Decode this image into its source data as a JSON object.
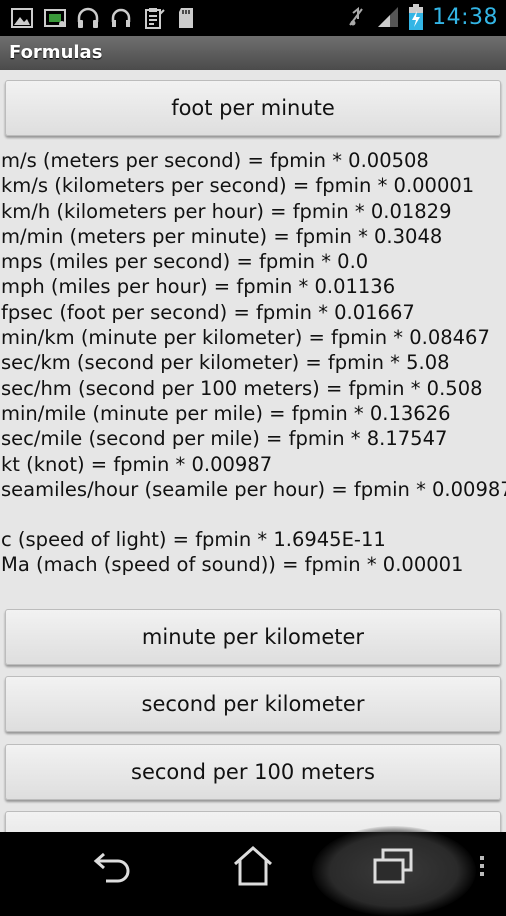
{
  "status_bar": {
    "time": "14:38",
    "left_icons": [
      "image-icon",
      "screen-icon",
      "headphones-icon",
      "headset-icon",
      "clipboard-icon",
      "sd-card-icon"
    ],
    "right_icons": [
      "mute-icon",
      "signal-icon",
      "battery-charging-icon"
    ],
    "time_color": "#33b5e5"
  },
  "title_bar": {
    "title": "Formulas"
  },
  "top_button": {
    "label": "foot per minute"
  },
  "formulas": [
    "m/s (meters per second) = fpmin * 0.00508",
    "km/s (kilometers per second) = fpmin * 0.00001",
    "km/h (kilometers per hour) = fpmin * 0.01829",
    "m/min (meters per minute) = fpmin * 0.3048",
    "mps (miles per second) = fpmin * 0.0",
    "mph (miles per hour) = fpmin * 0.01136",
    "fpsec (foot per second) = fpmin * 0.01667",
    "min/km (minute per kilometer) = fpmin * 0.08467",
    "sec/km (second per kilometer) = fpmin * 5.08",
    "sec/hm (second per 100 meters) = fpmin * 0.508",
    "min/mile (minute per mile) = fpmin * 0.13626",
    "sec/mile (second per mile) = fpmin * 8.17547",
    "kt (knot) = fpmin * 0.00987",
    "seamiles/hour (seamile per hour) = fpmin * 0.00987"
  ],
  "extra_formulas": [
    "c (speed of light) = fpmin * 1.6945E-11",
    "Ma (mach (speed of sound)) = fpmin * 0.00001"
  ],
  "unit_buttons": [
    {
      "label": "minute per kilometer"
    },
    {
      "label": "second per kilometer"
    },
    {
      "label": "second per 100 meters"
    },
    {
      "label": ""
    }
  ],
  "nav_bar": {
    "buttons": [
      "back-icon",
      "home-icon",
      "recent-apps-icon",
      "menu-icon"
    ]
  }
}
